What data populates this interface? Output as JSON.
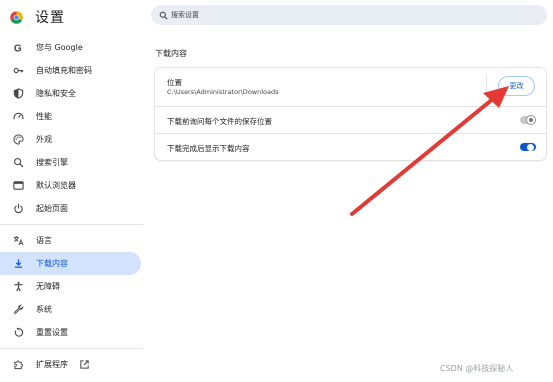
{
  "app": {
    "title": "设置"
  },
  "search": {
    "placeholder": "搜索设置"
  },
  "sidebar": {
    "items": [
      {
        "label": "您与 Google",
        "icon": "google-g-icon"
      },
      {
        "label": "自动填充和密码",
        "icon": "key-icon"
      },
      {
        "label": "隐私和安全",
        "icon": "shield-icon"
      },
      {
        "label": "性能",
        "icon": "speedometer-icon"
      },
      {
        "label": "外观",
        "icon": "palette-icon"
      },
      {
        "label": "搜索引擎",
        "icon": "search-icon"
      },
      {
        "label": "默认浏览器",
        "icon": "browser-window-icon"
      },
      {
        "label": "起始页面",
        "icon": "power-icon"
      },
      {
        "label": "语言",
        "icon": "translate-icon"
      },
      {
        "label": "下载内容",
        "icon": "download-icon",
        "active": true
      },
      {
        "label": "无障碍",
        "icon": "accessibility-icon"
      },
      {
        "label": "系统",
        "icon": "wrench-icon"
      },
      {
        "label": "重置设置",
        "icon": "reset-icon"
      },
      {
        "label": "扩展程序",
        "icon": "puzzle-icon",
        "external_icon": "open-in-new-icon"
      }
    ]
  },
  "main": {
    "section_title": "下载内容",
    "location": {
      "label": "位置",
      "path": "C:\\Users\\Administrator\\Downloads",
      "change_label": "更改"
    },
    "ask_where_to_save": {
      "label": "下载前询问每个文件的保存位置",
      "enabled": false
    },
    "show_downloads_when_done": {
      "label": "下载完成后显示下载内容",
      "enabled": true
    }
  },
  "annotation": {
    "type": "red-arrow",
    "color": "#e53935"
  },
  "watermark": "CSDN @科技探秘人",
  "colors": {
    "accent": "#0b57d0",
    "active_bg": "#d3e3fd",
    "search_bg": "#e9eef6"
  }
}
